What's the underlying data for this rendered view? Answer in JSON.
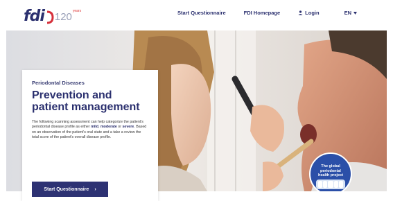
{
  "header": {
    "logo_text": "fdi",
    "logo_number": "120",
    "logo_sup": "years",
    "nav": {
      "start_questionnaire": "Start Questionnaire",
      "fdi_homepage": "FDI Homepage",
      "login": "Login",
      "language": "EN"
    }
  },
  "hero": {
    "card": {
      "kicker": "Periodontal Diseases",
      "title_line1": "Prevention and",
      "title_line2": "patient management",
      "body_prefix": "The following scanning assessment can help categorize the patient's periodontal disease profile as either ",
      "body_mild": "mild",
      "body_sep1": ", ",
      "body_moderate": "moderate",
      "body_sep2": " or ",
      "body_severe": "severe",
      "body_suffix": ". Based on an observation of the patient's oral state and a take a review the total score of the patient's overall disease profile.",
      "cta_label": "Start Questionnaire",
      "cta_arrow": "›"
    },
    "badge": {
      "line1": "The global",
      "line2": "periodontal",
      "line3": "health project"
    }
  },
  "colors": {
    "brand_navy": "#2a2f6e",
    "button": "#2d3273",
    "badge_blue": "#2b4fa8"
  }
}
